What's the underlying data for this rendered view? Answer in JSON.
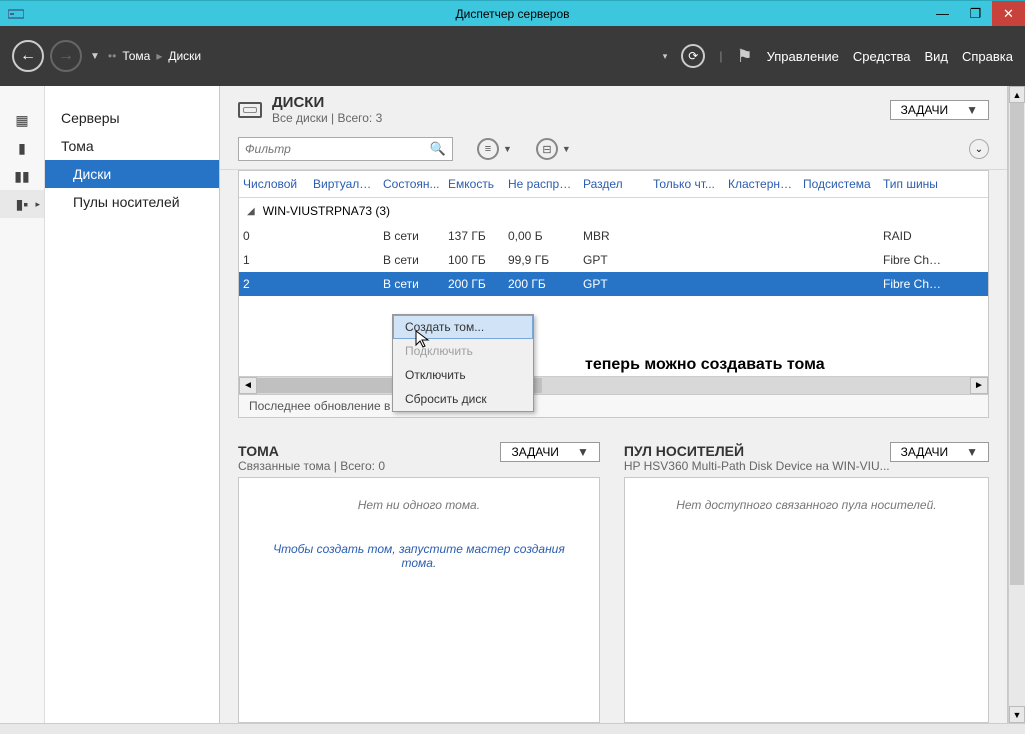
{
  "window": {
    "title": "Диспетчер серверов"
  },
  "breadcrumb": {
    "parent": "Тома",
    "current": "Диски",
    "prefix": "••"
  },
  "nav": {
    "manage": "Управление",
    "tools": "Средства",
    "view": "Вид",
    "help": "Справка"
  },
  "sidebar": {
    "items": [
      {
        "label": "Серверы",
        "sel": false,
        "indent": false
      },
      {
        "label": "Тома",
        "sel": false,
        "indent": false
      },
      {
        "label": "Диски",
        "sel": true,
        "indent": true
      },
      {
        "label": "Пулы носителей",
        "sel": false,
        "indent": true
      }
    ]
  },
  "disks": {
    "title": "ДИСКИ",
    "subtitle": "Все диски | Всего: 3",
    "tasks": "ЗАДАЧИ",
    "filter_placeholder": "Фильтр",
    "columns": [
      "Числовой",
      "Виртуальн...",
      "Состоян...",
      "Емкость",
      "Не распре...",
      "Раздел",
      "Только чт...",
      "Кластерный",
      "Подсистема",
      "Тип шины"
    ],
    "group": "WIN-VIUSTRPNA73 (3)",
    "rows": [
      {
        "num": "0",
        "virt": "",
        "state": "В сети",
        "cap": "137 ГБ",
        "unalloc": "0,00 Б",
        "part": "MBR",
        "ro": "",
        "clust": "",
        "subsys": "",
        "bus": "RAID"
      },
      {
        "num": "1",
        "virt": "",
        "state": "В сети",
        "cap": "100 ГБ",
        "unalloc": "99,9 ГБ",
        "part": "GPT",
        "ro": "",
        "clust": "",
        "subsys": "",
        "bus": "Fibre Cha..."
      },
      {
        "num": "2",
        "virt": "",
        "state": "В сети",
        "cap": "200 ГБ",
        "unalloc": "200 ГБ",
        "part": "GPT",
        "ro": "",
        "clust": "",
        "subsys": "",
        "bus": "Fibre Cha..."
      }
    ],
    "status": "Последнее обновление в 07.09.2016 15:30:00"
  },
  "ctx": {
    "create": "Создать том...",
    "connect": "Подключить",
    "disconnect": "Отключить",
    "reset": "Сбросить диск"
  },
  "annotation": "теперь можно создавать тома",
  "volumes": {
    "title": "ТОМА",
    "subtitle": "Связанные тома | Всего: 0",
    "tasks": "ЗАДАЧИ",
    "empty": "Нет ни одного тома.",
    "hint": "Чтобы создать том, запустите мастер создания тома."
  },
  "pools": {
    "title": "ПУЛ НОСИТЕЛЕЙ",
    "subtitle": "HP HSV360  Multi-Path Disk Device на WIN-VIU...",
    "tasks": "ЗАДАЧИ",
    "empty": "Нет доступного связанного пула носителей."
  }
}
